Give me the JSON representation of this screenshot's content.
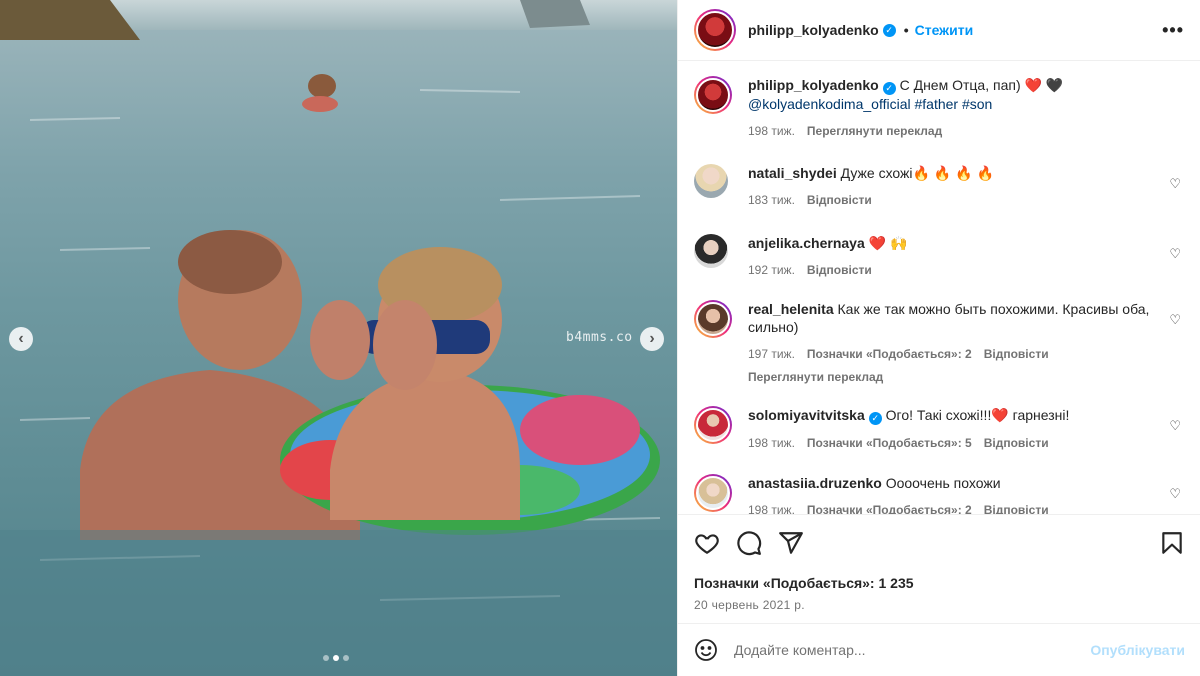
{
  "media": {
    "watermark": "b4mms.co",
    "prev_arrow": "‹",
    "next_arrow": "›",
    "slide_count": 3,
    "active_slide": 2
  },
  "header": {
    "username": "philipp_kolyadenko",
    "separator": "•",
    "follow_label": "Стежити",
    "more_label": "•••"
  },
  "caption": {
    "username": "philipp_kolyadenko",
    "text": "С Днем Отца, пап) ❤️ 🖤",
    "tags": "@kolyadenkodima_official #father #son",
    "time": "198 тиж.",
    "translate": "Переглянути переклад"
  },
  "comments": [
    {
      "username": "natali_shydei",
      "text": "Дуже схожі🔥 🔥 🔥 🔥",
      "time": "183 тиж.",
      "likes": "",
      "reply": "Відповісти",
      "translate": ""
    },
    {
      "username": "anjelika.chernaya",
      "text": "❤️ 🙌",
      "time": "192 тиж.",
      "likes": "",
      "reply": "Відповісти",
      "translate": ""
    },
    {
      "username": "real_helenita",
      "text": "Как же так можно быть похожими. Красивы оба, сильно)",
      "time": "197 тиж.",
      "likes": "Позначки «Подобається»: 2",
      "reply": "Відповісти",
      "translate": "Переглянути переклад"
    },
    {
      "username": "solomiyavitvitska",
      "text": "Ого! Такі схожі!!!❤️  гарнезні!",
      "time": "198 тиж.",
      "likes": "Позначки «Подобається»: 5",
      "reply": "Відповісти",
      "translate": ""
    },
    {
      "username": "anastasiia.druzenko",
      "text": "Оооочень похожи",
      "time": "198 тиж.",
      "likes": "Позначки «Подобається»: 2",
      "reply": "Відповісти",
      "translate": ""
    }
  ],
  "actions": {
    "likes_text": "Позначки «Подобається»: 1 235",
    "date": "20 червень 2021 р."
  },
  "add_comment": {
    "placeholder": "Додайте коментар...",
    "publish_label": "Опублікувати"
  },
  "colors": {
    "accent": "#0095f6",
    "publish_disabled": "#b2dffc",
    "muted": "#737373"
  }
}
